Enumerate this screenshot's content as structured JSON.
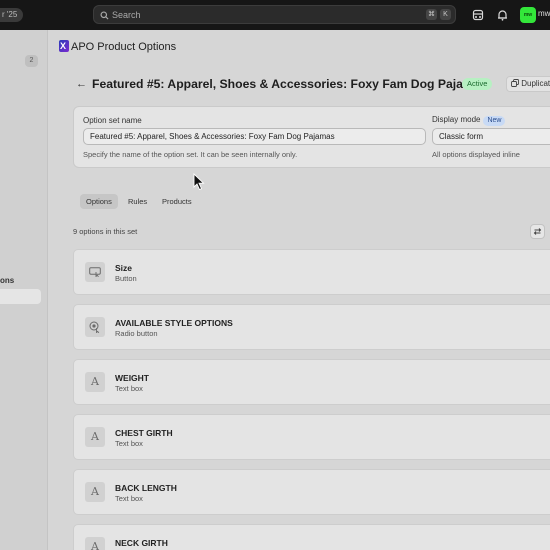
{
  "topbar": {
    "edition_pill": "r '25",
    "search_placeholder": "Search",
    "shortcut_keys": [
      "⌘",
      "K"
    ],
    "user_name": "mw",
    "avatar_text": "mw"
  },
  "sidebar": {
    "badge_count": "2",
    "section_label": "ons"
  },
  "app": {
    "title": "APO Product Options"
  },
  "page": {
    "heading": "Featured #5: Apparel, Shoes & Accessories: Foxy Fam Dog Pajamas",
    "status_badge": "Active",
    "duplicate_label": "Duplicate",
    "status_color": "#b7f0c2"
  },
  "form": {
    "name_label": "Option set name",
    "name_value": "Featured #5: Apparel, Shoes & Accessories: Foxy Fam Dog Pajamas",
    "name_help": "Specify the name of the option set. It can be seen internally only.",
    "display_label": "Display mode",
    "display_new_badge": "New",
    "display_value": "Classic form",
    "display_help": "All options displayed inline"
  },
  "tabs": [
    {
      "label": "Options",
      "active": true
    },
    {
      "label": "Rules",
      "active": false
    },
    {
      "label": "Products",
      "active": false
    }
  ],
  "options_count": "9 options in this set",
  "options": [
    {
      "name": "Size",
      "type": "Button",
      "icon": "button-icon",
      "glyph": ""
    },
    {
      "name": "AVAILABLE STYLE OPTIONS",
      "type": "Radio button",
      "icon": "radio-icon",
      "glyph": ""
    },
    {
      "name": "WEIGHT",
      "type": "Text box",
      "icon": "text-icon",
      "glyph": "A"
    },
    {
      "name": "CHEST GIRTH",
      "type": "Text box",
      "icon": "text-icon",
      "glyph": "A"
    },
    {
      "name": "BACK LENGTH",
      "type": "Text box",
      "icon": "text-icon",
      "glyph": "A"
    },
    {
      "name": "NECK GIRTH",
      "type": "Text box",
      "icon": "text-icon",
      "glyph": "A"
    }
  ]
}
